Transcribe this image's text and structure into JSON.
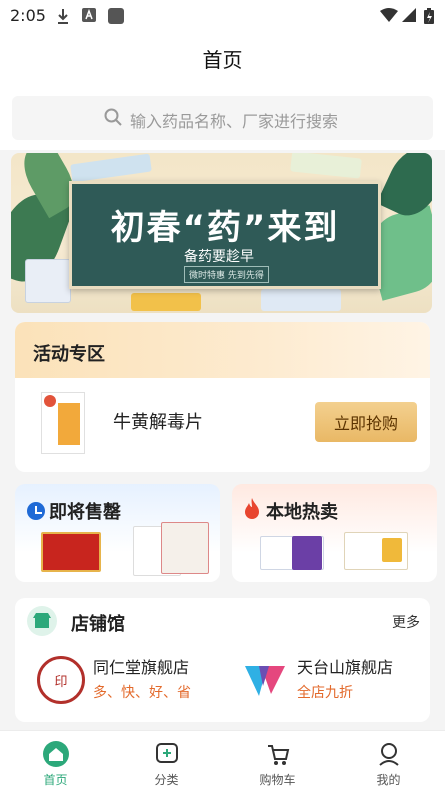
{
  "status_bar": {
    "time": "2:05"
  },
  "header": {
    "title": "首页"
  },
  "search": {
    "placeholder": "输入药品名称、厂家进行搜索"
  },
  "banner": {
    "title": "初春“药”来到",
    "subtitle": "备药要趁早",
    "tags": "微时特惠  先到先得"
  },
  "activity": {
    "title": "活动专区",
    "product_name": "牛黄解毒片",
    "buy_label": "立即抢购"
  },
  "promos": [
    {
      "title": "即将售罄",
      "icon": "clock-icon"
    },
    {
      "title": "本地热卖",
      "icon": "flame-icon"
    }
  ],
  "shops": {
    "title": "店铺馆",
    "more_label": "更多",
    "items": [
      {
        "name": "同仁堂旗舰店",
        "tagline": "多、快、好、省"
      },
      {
        "name": "天台山旗舰店",
        "tagline": "全店九折"
      }
    ]
  },
  "tabbar": {
    "items": [
      {
        "label": "首页",
        "icon": "home-icon",
        "active": true
      },
      {
        "label": "分类",
        "icon": "category-icon",
        "active": false
      },
      {
        "label": "购物车",
        "icon": "cart-icon",
        "active": false
      },
      {
        "label": "我的",
        "icon": "profile-icon",
        "active": false
      }
    ]
  },
  "colors": {
    "accent": "#2ca87a",
    "buy_button": "#e9b865",
    "tagline": "#e36a2c"
  }
}
